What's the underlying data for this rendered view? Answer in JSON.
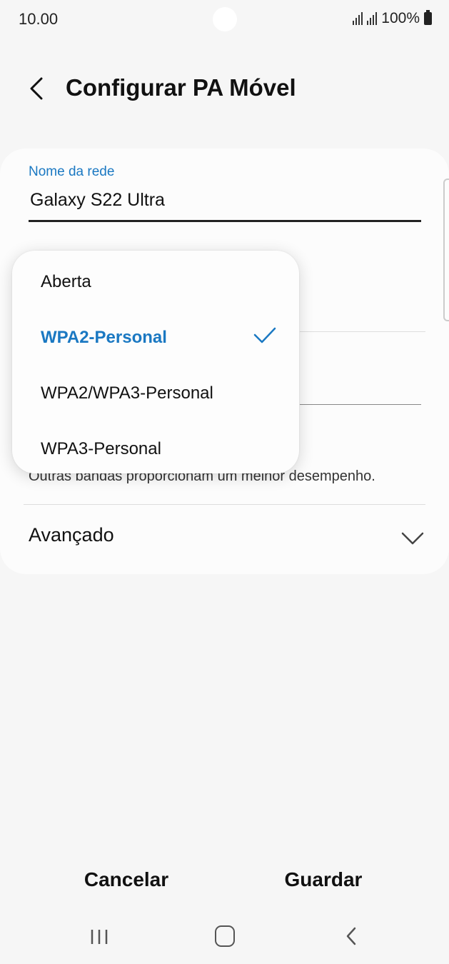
{
  "status_bar": {
    "time": "10.00",
    "battery": "100%"
  },
  "header": {
    "title": "Configurar PA Móvel"
  },
  "network_name": {
    "label": "Nome da rede",
    "value": "Galaxy S22 Ultra"
  },
  "security_dropdown": {
    "options": [
      {
        "label": "Aberta",
        "selected": false
      },
      {
        "label": "WPA2-Personal",
        "selected": true
      },
      {
        "label": "WPA2/WPA3-Personal",
        "selected": false
      },
      {
        "label": "WPA3-Personal",
        "selected": false
      }
    ]
  },
  "band": {
    "info": "Outras bandas proporcionam um melhor desempenho."
  },
  "advanced": {
    "label": "Avançado"
  },
  "actions": {
    "cancel_label": "Cancelar",
    "save_label": "Guardar"
  },
  "colors": {
    "accent": "#1a78c2",
    "background": "#f6f6f6",
    "card": "#fcfcfc"
  },
  "icons": {
    "back": "chevron-left-icon",
    "check": "check-icon",
    "advanced": "chevron-down-icon",
    "nav_recent": "recent-apps-icon",
    "nav_home": "home-icon",
    "nav_back": "back-nav-icon"
  }
}
